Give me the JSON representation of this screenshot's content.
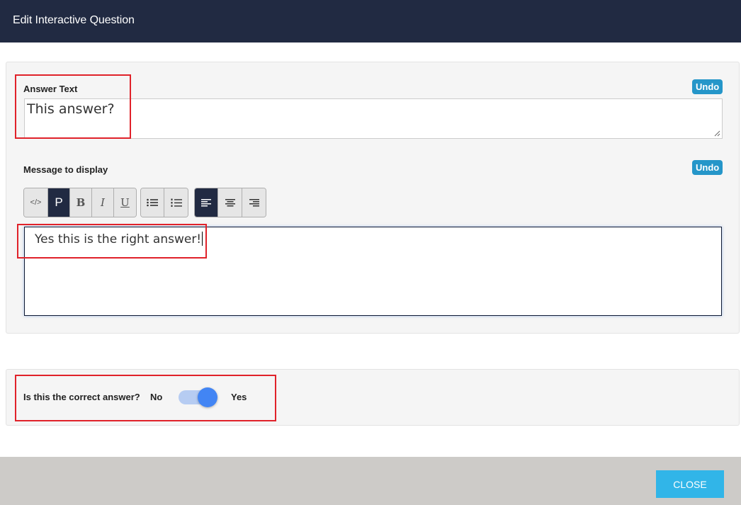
{
  "header": {
    "title": "Edit Interactive Question"
  },
  "answer": {
    "label": "Answer Text",
    "undo_label": "Undo",
    "value": "This answer?"
  },
  "message": {
    "label": "Message to display",
    "undo_label": "Undo",
    "value": "Yes this is the right answer!",
    "toolbar": {
      "code": "</>",
      "paragraph": "P",
      "bold": "B",
      "italic": "I",
      "underline": "U"
    }
  },
  "correct": {
    "question": "Is this the correct answer?",
    "off_label": "No",
    "on_label": "Yes",
    "toggle_on": true,
    "toggle_color": "#4285f4"
  },
  "footer": {
    "close_label": "CLOSE"
  },
  "colors": {
    "header_bg": "#212a42",
    "accent": "#31b5e8",
    "undo_bg": "#2596c9",
    "highlight_box": "#e0222a"
  }
}
